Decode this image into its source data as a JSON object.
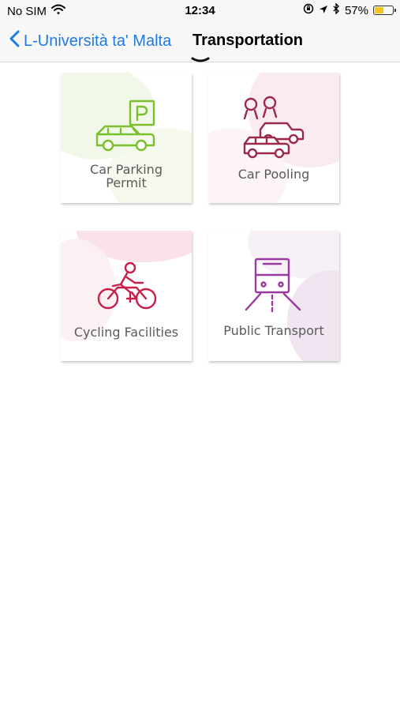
{
  "status_bar": {
    "carrier": "No SIM",
    "time": "12:34",
    "battery_percent": "57%",
    "battery_level": 0.57,
    "icons": [
      "wifi-icon",
      "orientation-lock-icon",
      "location-arrow-icon",
      "bluetooth-icon",
      "battery-icon"
    ]
  },
  "nav": {
    "back_label": "L-Università ta' Malta",
    "title": "Transportation",
    "back_icon": "chevron-left-icon"
  },
  "colors": {
    "accent_blue": "#1f7ae0",
    "parking_green": "#7cbf2c",
    "pooling_maroon": "#9b2a4a",
    "cycling_red": "#c8204a",
    "transport_purple": "#9a3aa0"
  },
  "tiles": [
    {
      "label": "Car Parking Permit",
      "icon": "car-parking-icon"
    },
    {
      "label": "Car Pooling",
      "icon": "car-pooling-icon"
    },
    {
      "label": "Cycling Facilities",
      "icon": "bicycle-icon"
    },
    {
      "label": "Public Transport",
      "icon": "train-icon"
    }
  ]
}
